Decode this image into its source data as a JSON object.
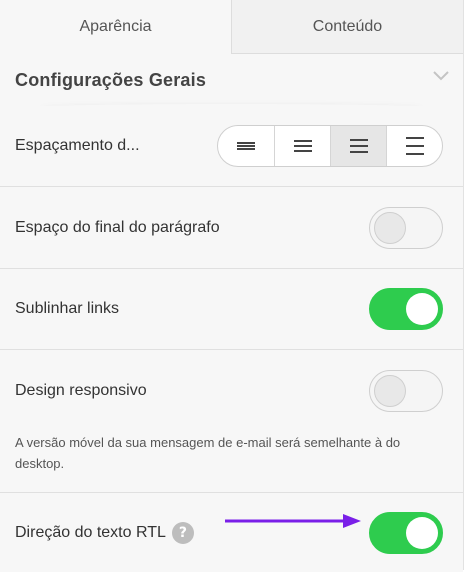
{
  "tabs": {
    "appearance": "Aparência",
    "content": "Conteúdo"
  },
  "section": {
    "title": "Configurações Gerais"
  },
  "settings": {
    "spacing_label": "Espaçamento d...",
    "paragraph_end_label": "Espaço do final do parágrafo",
    "underline_links_label": "Sublinhar links",
    "responsive_label": "Design responsivo",
    "responsive_desc": "A versão móvel da sua mensagem de e-mail será semelhante à do desktop.",
    "rtl_label": "Direção do texto RTL",
    "help_glyph": "?"
  },
  "states": {
    "spacing_selected_index": 2,
    "paragraph_end": "off",
    "underline_links": "on",
    "responsive": "off",
    "rtl": "on"
  },
  "colors": {
    "toggle_on": "#2ecc4e",
    "arrow": "#7a1fe8"
  },
  "icons": {
    "collapse": "chevron-up-icon",
    "spacing_options": [
      "spacing-compact-icon",
      "spacing-small-icon",
      "spacing-medium-icon",
      "spacing-large-icon"
    ],
    "help": "question-icon"
  }
}
